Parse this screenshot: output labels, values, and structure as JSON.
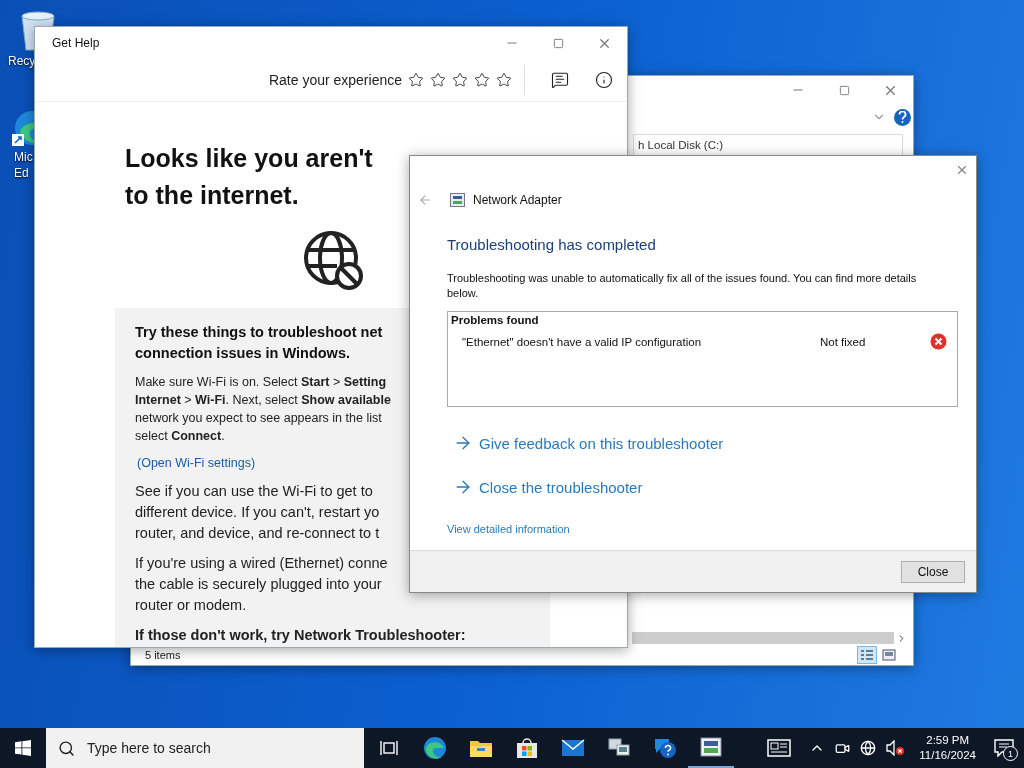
{
  "desktop_icons": [
    {
      "lines": [
        "Recy"
      ]
    },
    {
      "lines": [
        "Mic",
        "Ed"
      ]
    }
  ],
  "explorer": {
    "address": "h Local Disk (C:)",
    "status": "5 items"
  },
  "get_help": {
    "title": "Get Help",
    "rating_label": "Rate your experience",
    "stars": 0,
    "heading_lines": [
      "Looks like you aren't",
      "to the internet."
    ],
    "card": {
      "heading_lines": [
        "Try these things to troubleshoot net",
        "connection issues in Windows."
      ],
      "paragraphs": [
        {
          "kind": "small",
          "lines": [
            "Make sure Wi-Fi is on. Select **Start** > **Setting**",
            "**Internet** > **Wi-Fi**. Next, select **Show available**",
            "network you expect to see appears in the list",
            "select **Connect**."
          ]
        },
        {
          "kind": "link",
          "lines": [
            "(Open Wi-Fi settings)"
          ]
        },
        {
          "kind": "large",
          "lines": [
            "See if you can use the Wi-Fi to get to",
            "different device. If you can't, restart yo",
            "router, and device, and re-connect to t"
          ]
        },
        {
          "kind": "large",
          "lines": [
            "If you're using a wired (Ethernet) conne",
            "the cable is securely plugged into your",
            "router or modem."
          ]
        },
        {
          "kind": "subheading",
          "lines": [
            "If those don't work, try Network Troubleshooter:"
          ]
        }
      ]
    }
  },
  "dialog": {
    "app_title": "Network Adapter",
    "heading": "Troubleshooting has completed",
    "description": "Troubleshooting was unable to automatically fix all of the issues found. You can find more details below.",
    "problems_header": "Problems found",
    "problems": [
      {
        "text": "\"Ethernet\" doesn't have a valid IP configuration",
        "status": "Not fixed",
        "fixed": false
      }
    ],
    "links": [
      "Give feedback on this troubleshooter",
      "Close the troubleshooter"
    ],
    "detail_link": "View detailed information",
    "close_button": "Close"
  },
  "taskbar": {
    "search": {
      "placeholder": "Type here to search"
    },
    "time": "2:59 PM",
    "date": "11/16/2024",
    "notifications": "1"
  }
}
